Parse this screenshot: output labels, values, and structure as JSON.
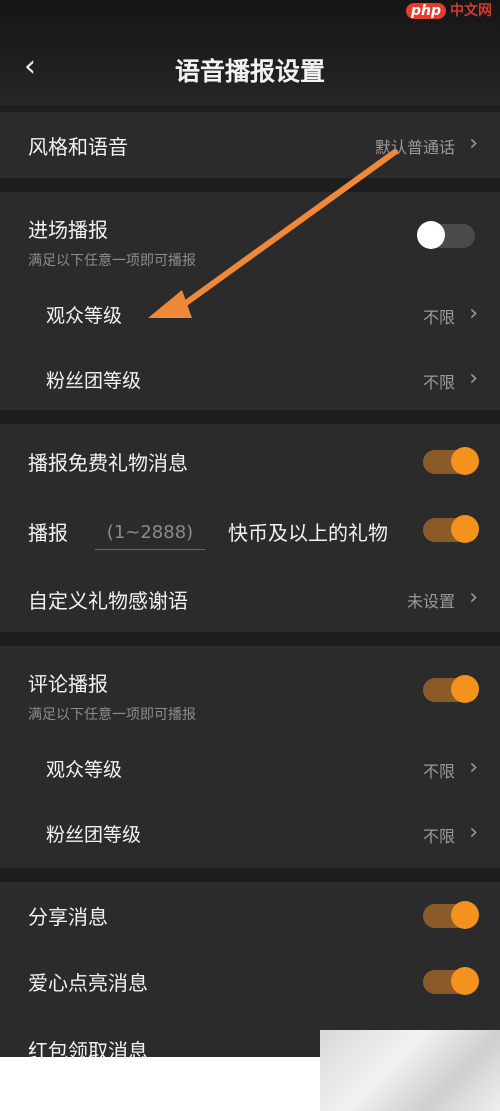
{
  "header": {
    "back_icon": "chevron-left-icon",
    "title": "语音播报设置"
  },
  "style": {
    "label": "风格和语音",
    "value": "默认普通话"
  },
  "entry": {
    "label": "进场播报",
    "hint": "满足以下任意一项即可播报",
    "toggle": false,
    "audience_level": {
      "label": "观众等级",
      "value": "不限"
    },
    "fan_level": {
      "label": "粉丝团等级",
      "value": "不限"
    }
  },
  "gifts": {
    "free_gift": {
      "label": "播报免费礼物消息",
      "toggle": true
    },
    "amount": {
      "prefix": "播报",
      "placeholder": "(1~2888)",
      "suffix": "快币及以上的礼物",
      "toggle": true
    },
    "thanks": {
      "label": "自定义礼物感谢语",
      "value": "未设置"
    }
  },
  "comments": {
    "label": "评论播报",
    "hint": "满足以下任意一项即可播报",
    "toggle": true,
    "audience_level": {
      "label": "观众等级",
      "value": "不限"
    },
    "fan_level": {
      "label": "粉丝团等级",
      "value": "不限"
    }
  },
  "others": {
    "share": {
      "label": "分享消息",
      "toggle": true
    },
    "heart": {
      "label": "爱心点亮消息",
      "toggle": true
    },
    "redpacket": {
      "label": "红包领取消息"
    }
  },
  "watermark": {
    "logo": "php",
    "text": "中文网"
  },
  "colors": {
    "accent": "#f5921e",
    "background": "#1e1e1e",
    "section": "#2b2b2b",
    "arrow": "#f0883a"
  }
}
